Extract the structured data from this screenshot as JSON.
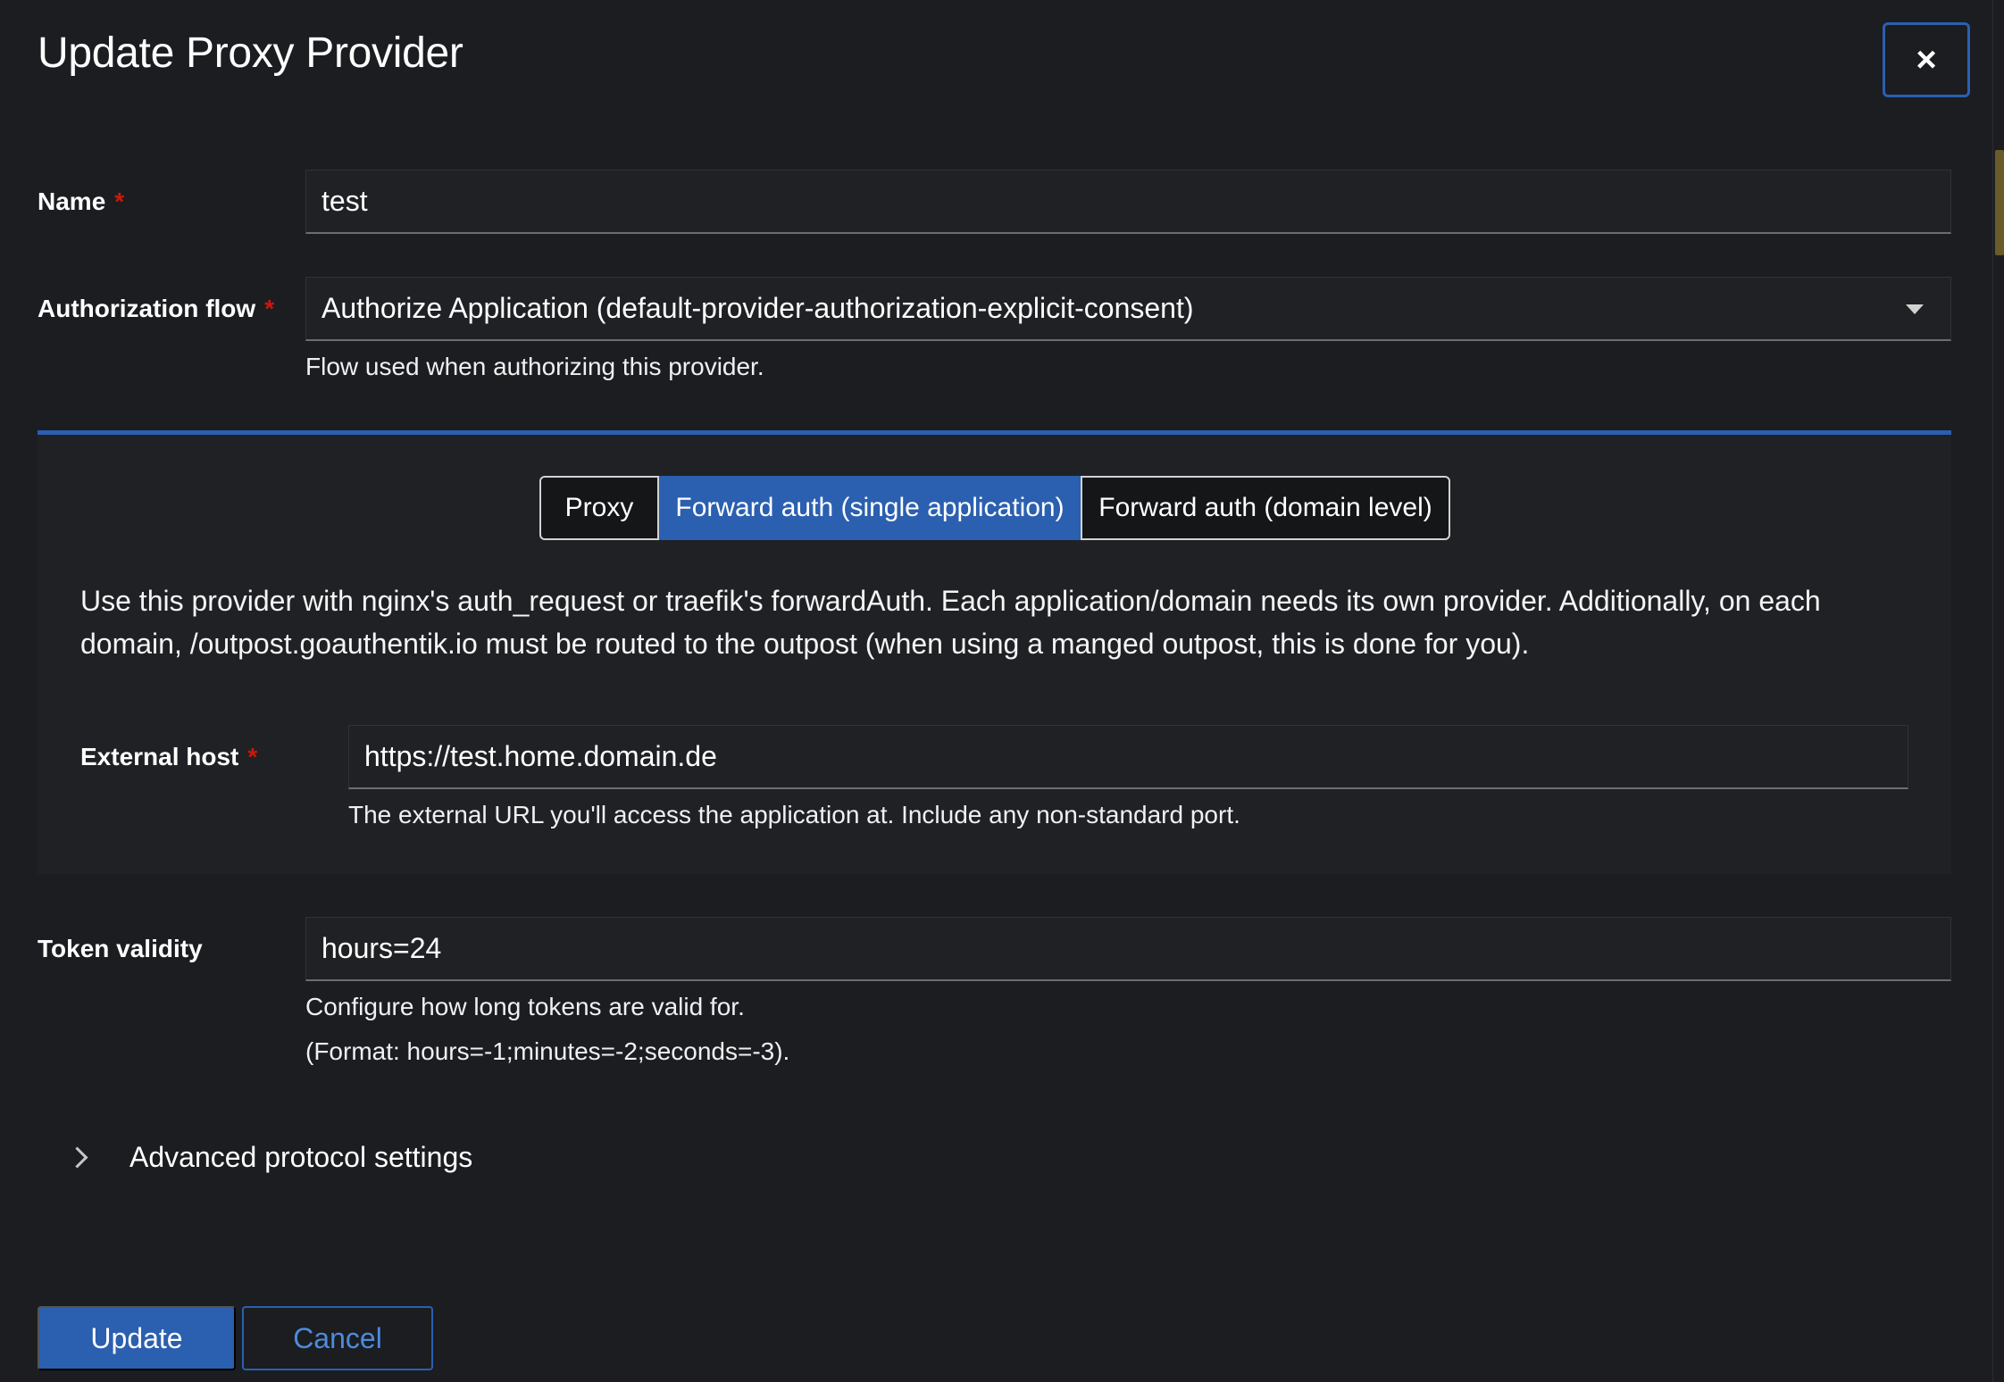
{
  "modal": {
    "title": "Update Proxy Provider",
    "close_symbol": "×"
  },
  "fields": {
    "name": {
      "label": "Name",
      "required_mark": "*",
      "value": "test"
    },
    "authorization_flow": {
      "label": "Authorization flow",
      "required_mark": "*",
      "value": "Authorize Application (default-provider-authorization-explicit-consent)",
      "helper": "Flow used when authorizing this provider."
    },
    "token_validity": {
      "label": "Token validity",
      "value": "hours=24",
      "helper_line1": "Configure how long tokens are valid for.",
      "helper_line2": "(Format: hours=-1;minutes=-2;seconds=-3)."
    }
  },
  "mode": {
    "options": [
      "Proxy",
      "Forward auth (single application)",
      "Forward auth (domain level)"
    ],
    "selected": "Forward auth (single application)",
    "description": "Use this provider with nginx's auth_request or traefik's forwardAuth. Each application/domain needs its own provider. Additionally, on each domain, /outpost.goauthentik.io must be routed to the outpost (when using a manged outpost, this is done for you).",
    "external_host": {
      "label": "External host",
      "required_mark": "*",
      "value": "https://test.home.domain.de",
      "helper": "The external URL you'll access the application at. Include any non-standard port."
    }
  },
  "advanced": {
    "label": "Advanced protocol settings",
    "icon": "chevron-right-icon",
    "expanded": false
  },
  "footer": {
    "update_label": "Update",
    "cancel_label": "Cancel"
  },
  "colors": {
    "accent": "#2b5fb0",
    "required": "#c9190b",
    "background": "#1b1d21"
  }
}
